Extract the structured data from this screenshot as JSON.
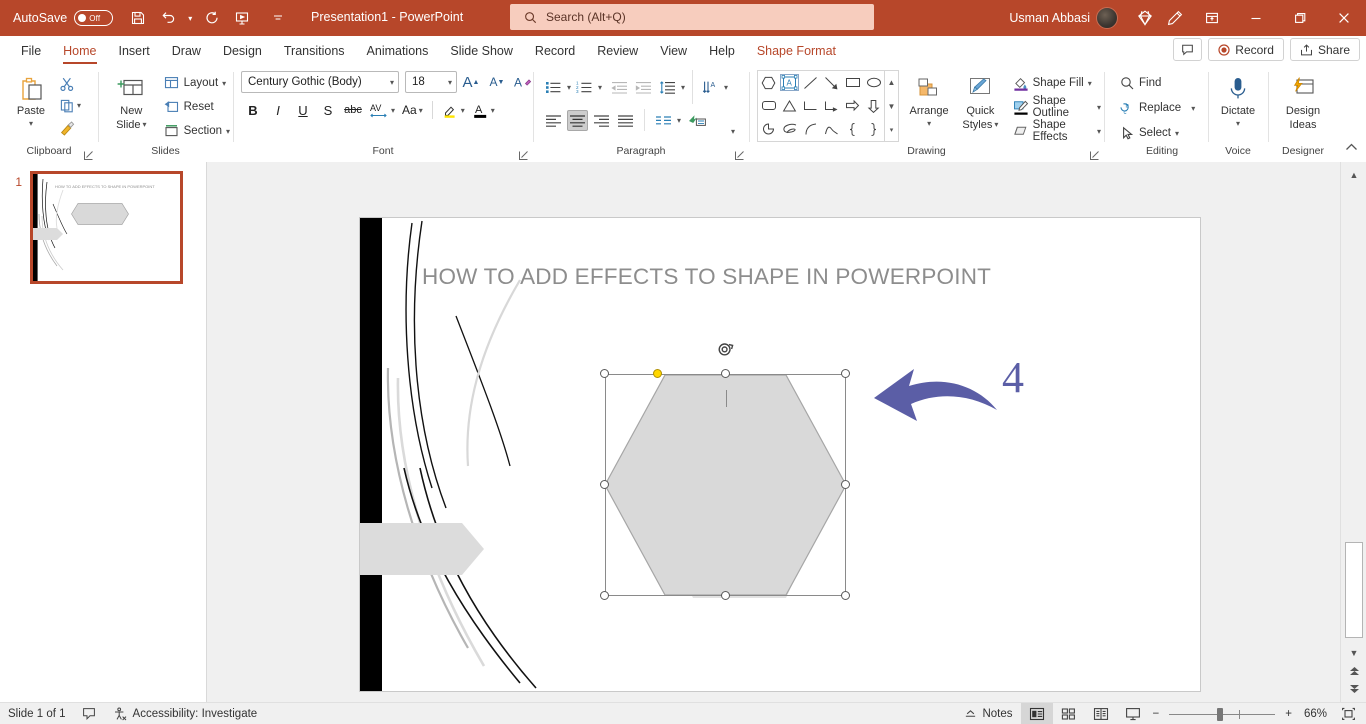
{
  "titlebar": {
    "autosave_label": "AutoSave",
    "autosave_state": "Off",
    "save_icon": "save-icon",
    "undo_icon": "undo-icon",
    "redo_icon": "redo-icon",
    "present_icon": "start-presentation-icon",
    "customize_icon": "customize-quick-access-icon",
    "document_title": "Presentation1  -  PowerPoint",
    "search_placeholder": "Search (Alt+Q)",
    "search_icon": "search-icon",
    "user_name": "Usman Abbasi",
    "avatar": "user-avatar",
    "diamond_icon": "microsoft-365-diamond-icon",
    "pen_icon": "ink-pen-icon",
    "ribbon_display_icon": "ribbon-display-options-icon",
    "minimize_icon": "minimize-icon",
    "restore_icon": "restore-icon",
    "close_icon": "close-icon",
    "accent_color": "#b7472a",
    "search_bg": "#f7cdbe"
  },
  "tabs": [
    {
      "label": "File",
      "active": false
    },
    {
      "label": "Home",
      "active": true
    },
    {
      "label": "Insert",
      "active": false
    },
    {
      "label": "Draw",
      "active": false
    },
    {
      "label": "Design",
      "active": false
    },
    {
      "label": "Transitions",
      "active": false
    },
    {
      "label": "Animations",
      "active": false
    },
    {
      "label": "Slide Show",
      "active": false
    },
    {
      "label": "Record",
      "active": false
    },
    {
      "label": "Review",
      "active": false
    },
    {
      "label": "View",
      "active": false
    },
    {
      "label": "Help",
      "active": false
    },
    {
      "label": "Shape Format",
      "active": false,
      "contextual": true
    }
  ],
  "tabs_right": {
    "comments_icon": "comments-icon",
    "record_label": "Record",
    "record_icon": "record-dot-icon",
    "share_label": "Share",
    "share_icon": "share-icon"
  },
  "ribbon": {
    "clipboard": {
      "group_label": "Clipboard",
      "paste_label": "Paste",
      "cut_label": "Cut",
      "copy_label": "Copy",
      "format_painter_label": "Format Painter",
      "launcher": "clipboard-dialog-launcher"
    },
    "slides": {
      "group_label": "Slides",
      "new_slide_label": "New\nSlide",
      "new_slide_line1": "New",
      "new_slide_line2": "Slide",
      "layout_label": "Layout",
      "reset_label": "Reset",
      "section_label": "Section"
    },
    "font": {
      "group_label": "Font",
      "font_name": "Century Gothic (Body)",
      "font_size": "18",
      "grow_font": "A",
      "shrink_font": "A",
      "clear_formatting": "clear-formatting-icon",
      "bold": "B",
      "italic": "I",
      "underline": "U",
      "shadow": "S",
      "strikethrough": "abc",
      "character_spacing": "AV",
      "change_case": "Aa",
      "text_highlight": "text-highlight-color-icon",
      "font_color": "A",
      "launcher": "font-dialog-launcher"
    },
    "paragraph": {
      "group_label": "Paragraph",
      "bullets": "bullets-icon",
      "numbering": "numbering-icon",
      "decrease_indent": "decrease-indent-icon",
      "increase_indent": "increase-indent-icon",
      "line_spacing": "line-spacing-icon",
      "text_direction": "text-direction-icon",
      "align_text": "align-text-icon",
      "convert_smartart": "convert-to-smartart-icon",
      "align_left": "align-left-icon",
      "align_center": "align-center-icon",
      "align_right": "align-right-icon",
      "justify": "justify-icon",
      "columns": "columns-icon",
      "active_alignment": "align-center",
      "launcher": "paragraph-dialog-launcher"
    },
    "drawing": {
      "group_label": "Drawing",
      "arrange_label": "Arrange",
      "quick_styles_line1": "Quick",
      "quick_styles_line2": "Styles",
      "shape_fill_label": "Shape Fill",
      "shape_outline_label": "Shape Outline",
      "shape_effects_label": "Shape Effects",
      "shape_fill_color": "#7030a0",
      "shape_outline_color": "#000000",
      "shapes": [
        "hexagon-shape",
        "text-box-shape",
        "line-shape",
        "arrow-line-shape",
        "rectangle-shape",
        "oval-shape",
        "rounded-rectangle-shape",
        "triangle-shape",
        "elbow-connector-shape",
        "elbow-arrow-connector-shape",
        "right-arrow-shape",
        "down-arrow-shape",
        "pie-shape",
        "scribble-shape",
        "arc-shape",
        "curve-shape",
        "left-brace-shape",
        "right-brace-shape"
      ],
      "selected_shape_index": 1,
      "launcher": "drawing-dialog-launcher"
    },
    "editing": {
      "group_label": "Editing",
      "find_label": "Find",
      "replace_label": "Replace",
      "select_label": "Select"
    },
    "voice": {
      "group_label": "Voice",
      "dictate_label": "Dictate",
      "dictate_icon": "microphone-icon"
    },
    "designer": {
      "group_label": "Designer",
      "design_ideas_line1": "Design",
      "design_ideas_line2": "Ideas",
      "design_ideas_icon": "design-ideas-icon",
      "collapse_ribbon_icon": "collapse-ribbon-icon"
    }
  },
  "thumbnails": [
    {
      "number": "1",
      "selected": true,
      "title": "HOW TO ADD EFFECTS TO SHAPE IN POWERPOINT"
    }
  ],
  "slide": {
    "title": "HOW TO ADD EFFECTS TO SHAPE IN POWERPOINT",
    "title_color": "#8d8d8d",
    "shape": {
      "name": "hexagon",
      "fill": "#d9d9d9",
      "outline": "#a6a6a6",
      "selected": true,
      "shadow": true,
      "handles": [
        "top-left",
        "top-center",
        "top-right",
        "middle-left",
        "middle-right",
        "bottom-left",
        "bottom-center",
        "bottom-right"
      ],
      "adjustment_handle": "yellow-adjustment-handle",
      "rotate_handle": "rotate-handle"
    },
    "annotation": {
      "arrow": "curved-left-arrow-annotation",
      "arrow_color": "#5b5ea6",
      "step_number": "4"
    },
    "decorations": {
      "left_bar_color": "#000000",
      "banner_shape": "pentagon-banner",
      "banner_color": "#dcdcdc"
    }
  },
  "scrollbar": {
    "up_icon": "scroll-up-icon",
    "down_icon": "scroll-down-icon",
    "prev_slide_icon": "previous-slide-icon",
    "next_slide_icon": "next-slide-icon",
    "collapse_icon": "collapse-icon"
  },
  "statusbar": {
    "slide_count": "Slide 1 of 1",
    "notes_page_icon": "notes-page-icon",
    "accessibility_icon": "accessibility-icon",
    "accessibility_label": "Accessibility: Investigate",
    "notes_label": "Notes",
    "notes_icon": "notes-icon",
    "views": [
      {
        "name": "normal-view",
        "active": true
      },
      {
        "name": "slide-sorter-view",
        "active": false
      },
      {
        "name": "reading-view",
        "active": false
      },
      {
        "name": "slide-show-view",
        "active": false
      }
    ],
    "zoom_out": "−",
    "zoom_in": "+",
    "zoom_level": "66%",
    "fit_to_window_icon": "fit-slide-to-window-icon"
  }
}
